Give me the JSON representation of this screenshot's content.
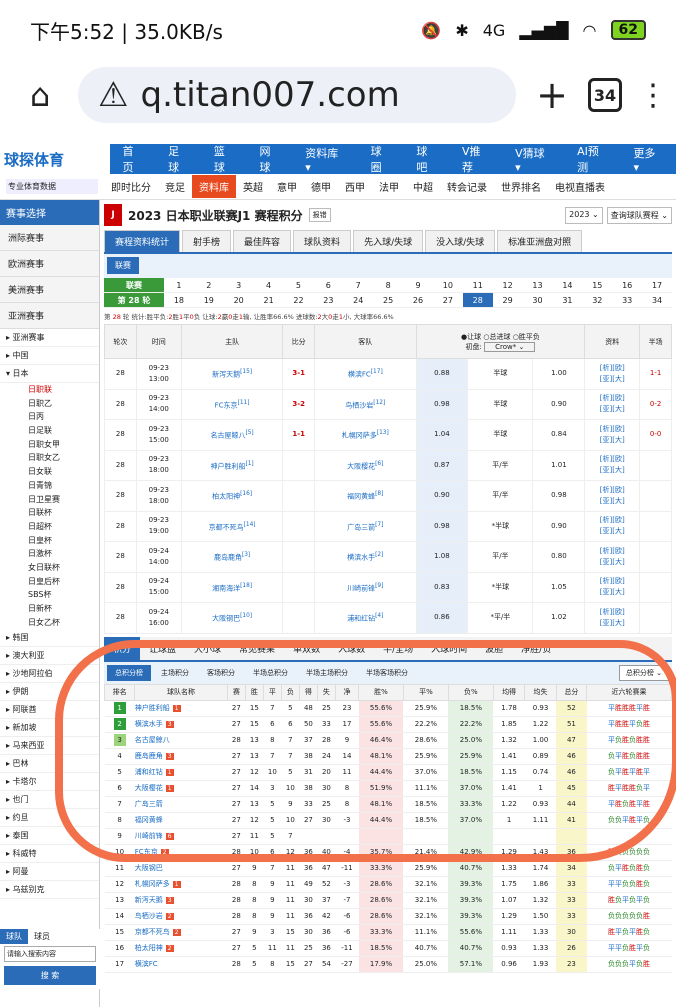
{
  "status": {
    "time": "下午5:52 | 35.0KB/s",
    "network": "4G",
    "battery": "62"
  },
  "browser": {
    "url": "q.titan007.com",
    "tabs_count": "34"
  },
  "site": {
    "logo": "球探体育",
    "nav": [
      "首页",
      "足球",
      "篮球",
      "网球",
      "资料库 ▾",
      "球圈",
      "球吧",
      "V推荐",
      "V猜球 ▾",
      "AI预测",
      "更多 ▾"
    ],
    "sub_brand": "专业体育数据",
    "subnav": [
      "即时比分",
      "竞足",
      "资料库",
      "英超",
      "意甲",
      "德甲",
      "西甲",
      "法甲",
      "中超",
      "转会记录",
      "世界排名",
      "电视直播表"
    ],
    "subnav_active": "资料库"
  },
  "sidebar": {
    "title": "赛事选择",
    "categories": [
      "洲际赛事",
      "欧洲赛事",
      "美洲赛事",
      "亚洲赛事"
    ],
    "countries_top": [
      "▸ 亚洲赛事",
      "▸ 中国",
      "▾ 日本"
    ],
    "leagues": [
      "日职联",
      "日职乙",
      "日丙",
      "日足联",
      "日职女甲",
      "日职女乙",
      "日女联",
      "日青锦",
      "日卫星赛",
      "日联杯",
      "日超杯",
      "日皇杯",
      "日激杯",
      "女日联杯",
      "日皇后杯",
      "SBS杯",
      "日新杯",
      "日女乙杯"
    ],
    "active_league": "日职联",
    "countries_bottom": [
      "▸ 韩国",
      "▸ 澳大利亚",
      "▸ 沙地阿拉伯",
      "▸ 伊朗",
      "▸ 阿联酋",
      "▸ 新加坡",
      "▸ 马来西亚",
      "▸ 巴林",
      "▸ 卡塔尔",
      "▸ 也门",
      "▸ 约旦",
      "▸ 泰国",
      "▸ 科威特",
      "▸ 阿曼",
      "▸ 乌兹别克"
    ],
    "search_tabs": [
      "球队",
      "球员"
    ],
    "search_placeholder": "请输入搜索内容",
    "search_button": "搜 索"
  },
  "page": {
    "logo": "J",
    "title": "2023 日本职业联赛J1 赛程积分",
    "tag": "报错",
    "season": "2023 ⌄",
    "query": "查询球队赛程 ⌄",
    "tabs": [
      "赛程资料统计",
      "射手榜",
      "最佳阵容",
      "球队资料",
      "先入球/失球",
      "没入球/失球",
      "标准亚洲盘对照"
    ],
    "subtab": "联赛",
    "round_label": "联赛",
    "round_current": "第 28 轮",
    "rounds_row1": [
      "1",
      "2",
      "3",
      "4",
      "5",
      "6",
      "7",
      "8",
      "9",
      "10",
      "11",
      "12",
      "13",
      "14",
      "15",
      "16",
      "17"
    ],
    "rounds_row2": [
      "18",
      "19",
      "20",
      "21",
      "22",
      "23",
      "24",
      "25",
      "26",
      "27",
      "28",
      "29",
      "30",
      "31",
      "32",
      "33",
      "34"
    ],
    "selected_round": "28",
    "note": {
      "a": "第 ",
      "round": "28",
      "b": " 轮 统计:胜平负:",
      "w": "2",
      "c": "胜",
      "d": "1",
      "e": "平",
      "f": "0",
      "g": "负 让球:",
      "h": "2",
      "i": "赢",
      "j": "0",
      "k": "走",
      "l": "1",
      "m": "输, 让胜率66.6% 进球数:",
      "n": "2",
      "o": "大",
      "p": "0",
      "q": "走",
      "r": "1",
      "s": "小, 大球率66.6%"
    }
  },
  "fixtures": {
    "headers": [
      "轮次",
      "时间",
      "主队",
      "比分",
      "客队",
      "",
      "",
      "",
      "资料",
      "半场"
    ],
    "handicap_options": [
      "●让球",
      "○总进球",
      "○胜平负"
    ],
    "odds_label": "初盘:",
    "odds_source": "Crow* ⌄",
    "rows": [
      {
        "round": "28",
        "date": "09-23",
        "time": "13:00",
        "home": "新泻天鹅",
        "home_rank": "[15]",
        "score": "3-1",
        "away": "横滨FC",
        "away_rank": "[17]",
        "o1": "0.88",
        "line": "半球",
        "o2": "1.00",
        "half": "1-1"
      },
      {
        "round": "28",
        "date": "09-23",
        "time": "14:00",
        "home": "FC东京",
        "home_rank": "[11]",
        "score": "3-2",
        "away": "鸟栖沙岩",
        "away_rank": "[12]",
        "o1": "0.98",
        "line": "半球",
        "o2": "0.90",
        "half": "0-2"
      },
      {
        "round": "28",
        "date": "09-23",
        "time": "15:00",
        "home": "名古屋鲸八",
        "home_rank": "[5]",
        "score": "1-1",
        "away": "札幌冈萨多",
        "away_rank": "[13]",
        "o1": "1.04",
        "line": "半球",
        "o2": "0.84",
        "half": "0-0"
      },
      {
        "round": "28",
        "date": "09-23",
        "time": "18:00",
        "home": "神户胜利船",
        "home_rank": "[1]",
        "score": "",
        "away": "大阪樱花",
        "away_rank": "[6]",
        "o1": "0.87",
        "line": "平/半",
        "o2": "1.01",
        "half": ""
      },
      {
        "round": "28",
        "date": "09-23",
        "time": "18:00",
        "home": "柏太阳神",
        "home_rank": "[16]",
        "score": "",
        "away": "福冈黄蜂",
        "away_rank": "[8]",
        "o1": "0.90",
        "line": "平/半",
        "o2": "0.98",
        "half": ""
      },
      {
        "round": "28",
        "date": "09-23",
        "time": "19:00",
        "home": "京都不死鸟",
        "home_rank": "[14]",
        "score": "",
        "away": "广岛三箭",
        "away_rank": "[7]",
        "o1": "0.98",
        "line": "*半球",
        "o2": "0.90",
        "half": ""
      },
      {
        "round": "28",
        "date": "09-24",
        "time": "14:00",
        "home": "鹿岛鹿角",
        "home_rank": "[3]",
        "score": "",
        "away": "横滨水手",
        "away_rank": "[2]",
        "o1": "1.08",
        "line": "平/半",
        "o2": "0.80",
        "half": ""
      },
      {
        "round": "28",
        "date": "09-24",
        "time": "15:00",
        "home": "湘南海洋",
        "home_rank": "[18]",
        "score": "",
        "away": "川崎前锋",
        "away_rank": "[9]",
        "o1": "0.83",
        "line": "*半球",
        "o2": "1.05",
        "half": ""
      },
      {
        "round": "28",
        "date": "09-24",
        "time": "16:00",
        "home": "大阪钢巴",
        "home_rank": "[10]",
        "score": "",
        "away": "浦和红钻",
        "away_rank": "[4]",
        "o1": "0.86",
        "line": "*平/半",
        "o2": "1.02",
        "half": ""
      }
    ],
    "links_a": "[析][欧]",
    "links_b": "[亚][大]"
  },
  "stats_tabs": [
    "积分",
    "让球盘",
    "大小球",
    "常见赛果",
    "单双数",
    "入球数",
    "半/全场",
    "入球时间",
    "波胆",
    "净胜/负"
  ],
  "stand_tabs": [
    "总积分榜",
    "主场积分",
    "客场积分",
    "半场总积分",
    "半场主场积分",
    "半场客场积分"
  ],
  "stand_select": "总积分榜 ⌄",
  "standings": {
    "headers": [
      "排名",
      "球队名称",
      "赛",
      "胜",
      "平",
      "负",
      "得",
      "失",
      "净",
      "胜%",
      "平%",
      "负%",
      "均得",
      "均失",
      "总分",
      "近六轮赛果"
    ],
    "rows": [
      {
        "rank": "1",
        "name": "神户胜利船",
        "badge": "1",
        "p": "27",
        "w": "15",
        "d": "7",
        "l": "5",
        "gf": "48",
        "ga": "25",
        "gd": "23",
        "wp": "55.6%",
        "dp": "25.9%",
        "lp": "18.5%",
        "ag": "1.78",
        "al": "0.93",
        "pts": "52",
        "form": [
          "平",
          "胜",
          "胜",
          "胜",
          "平",
          "胜"
        ]
      },
      {
        "rank": "2",
        "name": "横滨水手",
        "badge": "3",
        "p": "27",
        "w": "15",
        "d": "6",
        "l": "6",
        "gf": "50",
        "ga": "33",
        "gd": "17",
        "wp": "55.6%",
        "dp": "22.2%",
        "lp": "22.2%",
        "ag": "1.85",
        "al": "1.22",
        "pts": "51",
        "form": [
          "平",
          "胜",
          "胜",
          "平",
          "负",
          "胜"
        ]
      },
      {
        "rank": "3",
        "name": "名古屋鲸八",
        "badge": "",
        "p": "28",
        "w": "13",
        "d": "8",
        "l": "7",
        "gf": "37",
        "ga": "28",
        "gd": "9",
        "wp": "46.4%",
        "dp": "28.6%",
        "lp": "25.0%",
        "ag": "1.32",
        "al": "1.00",
        "pts": "47",
        "form": [
          "平",
          "负",
          "胜",
          "负",
          "胜",
          "胜"
        ]
      },
      {
        "rank": "4",
        "name": "鹿岛鹿角",
        "badge": "3",
        "p": "27",
        "w": "13",
        "d": "7",
        "l": "7",
        "gf": "38",
        "ga": "24",
        "gd": "14",
        "wp": "48.1%",
        "dp": "25.9%",
        "lp": "25.9%",
        "ag": "1.41",
        "al": "0.89",
        "pts": "46",
        "form": [
          "负",
          "平",
          "胜",
          "负",
          "胜",
          "胜"
        ]
      },
      {
        "rank": "5",
        "name": "浦和红钻",
        "badge": "1",
        "p": "27",
        "w": "12",
        "d": "10",
        "l": "5",
        "gf": "31",
        "ga": "20",
        "gd": "11",
        "wp": "44.4%",
        "dp": "37.0%",
        "lp": "18.5%",
        "ag": "1.15",
        "al": "0.74",
        "pts": "46",
        "form": [
          "负",
          "平",
          "胜",
          "平",
          "胜",
          "平"
        ]
      },
      {
        "rank": "6",
        "name": "大阪樱花",
        "badge": "1",
        "p": "27",
        "w": "14",
        "d": "3",
        "l": "10",
        "gf": "38",
        "ga": "30",
        "gd": "8",
        "wp": "51.9%",
        "dp": "11.1%",
        "lp": "37.0%",
        "ag": "1.41",
        "al": "1",
        "pts": "45",
        "form": [
          "胜",
          "平",
          "胜",
          "胜",
          "负",
          "平"
        ]
      },
      {
        "rank": "7",
        "name": "广岛三箭",
        "badge": "",
        "p": "27",
        "w": "13",
        "d": "5",
        "l": "9",
        "gf": "33",
        "ga": "25",
        "gd": "8",
        "wp": "48.1%",
        "dp": "18.5%",
        "lp": "33.3%",
        "ag": "1.22",
        "al": "0.93",
        "pts": "44",
        "form": [
          "平",
          "胜",
          "负",
          "胜",
          "平",
          "胜"
        ]
      },
      {
        "rank": "8",
        "name": "福冈黄蜂",
        "badge": "",
        "p": "27",
        "w": "12",
        "d": "5",
        "l": "10",
        "gf": "27",
        "ga": "30",
        "gd": "-3",
        "wp": "44.4%",
        "dp": "18.5%",
        "lp": "37.0%",
        "ag": "1",
        "al": "1.11",
        "pts": "41",
        "form": [
          "负",
          "负",
          "平",
          "胜",
          "平",
          "负"
        ]
      },
      {
        "rank": "9",
        "name": "川崎前锋",
        "badge": "6",
        "p": "27",
        "w": "11",
        "d": "5",
        "l": "7",
        "gf": "",
        "ga": "",
        "gd": "",
        "wp": "",
        "dp": "",
        "lp": "",
        "ag": "",
        "al": "",
        "pts": "",
        "form": [
          "",
          "",
          "",
          "",
          "",
          ""
        ]
      },
      {
        "rank": "10",
        "name": "FC东京",
        "badge": "2",
        "p": "28",
        "w": "10",
        "d": "6",
        "l": "12",
        "gf": "36",
        "ga": "40",
        "gd": "-4",
        "wp": "35.7%",
        "dp": "21.4%",
        "lp": "42.9%",
        "ag": "1.29",
        "al": "1.43",
        "pts": "36",
        "form": [
          "胜",
          "负",
          "负",
          "负",
          "负",
          "负"
        ]
      },
      {
        "rank": "11",
        "name": "大阪钢巴",
        "badge": "",
        "p": "27",
        "w": "9",
        "d": "7",
        "l": "11",
        "gf": "36",
        "ga": "47",
        "gd": "-11",
        "wp": "33.3%",
        "dp": "25.9%",
        "lp": "40.7%",
        "ag": "1.33",
        "al": "1.74",
        "pts": "34",
        "form": [
          "负",
          "平",
          "胜",
          "负",
          "胜",
          "负"
        ]
      },
      {
        "rank": "12",
        "name": "札幌冈萨多",
        "badge": "1",
        "p": "28",
        "w": "8",
        "d": "9",
        "l": "11",
        "gf": "49",
        "ga": "52",
        "gd": "-3",
        "wp": "28.6%",
        "dp": "32.1%",
        "lp": "39.3%",
        "ag": "1.75",
        "al": "1.86",
        "pts": "33",
        "form": [
          "平",
          "平",
          "负",
          "负",
          "胜",
          "负"
        ]
      },
      {
        "rank": "13",
        "name": "新泻天鹅",
        "badge": "3",
        "p": "28",
        "w": "8",
        "d": "9",
        "l": "11",
        "gf": "30",
        "ga": "37",
        "gd": "-7",
        "wp": "28.6%",
        "dp": "32.1%",
        "lp": "39.3%",
        "ag": "1.07",
        "al": "1.32",
        "pts": "33",
        "form": [
          "胜",
          "负",
          "平",
          "负",
          "平",
          "负"
        ]
      },
      {
        "rank": "14",
        "name": "鸟栖沙岩",
        "badge": "2",
        "p": "28",
        "w": "8",
        "d": "9",
        "l": "11",
        "gf": "36",
        "ga": "42",
        "gd": "-6",
        "wp": "28.6%",
        "dp": "32.1%",
        "lp": "39.3%",
        "ag": "1.29",
        "al": "1.50",
        "pts": "33",
        "form": [
          "负",
          "负",
          "负",
          "负",
          "负",
          "胜"
        ]
      },
      {
        "rank": "15",
        "name": "京都不死鸟",
        "badge": "2",
        "p": "27",
        "w": "9",
        "d": "3",
        "l": "15",
        "gf": "30",
        "ga": "36",
        "gd": "-6",
        "wp": "33.3%",
        "dp": "11.1%",
        "lp": "55.6%",
        "ag": "1.11",
        "al": "1.33",
        "pts": "30",
        "form": [
          "胜",
          "平",
          "负",
          "平",
          "胜",
          "负"
        ]
      },
      {
        "rank": "16",
        "name": "柏太阳神",
        "badge": "2",
        "p": "27",
        "w": "5",
        "d": "11",
        "l": "11",
        "gf": "25",
        "ga": "36",
        "gd": "-11",
        "wp": "18.5%",
        "dp": "40.7%",
        "lp": "40.7%",
        "ag": "0.93",
        "al": "1.33",
        "pts": "26",
        "form": [
          "平",
          "平",
          "负",
          "胜",
          "平",
          "负"
        ]
      },
      {
        "rank": "17",
        "name": "横滨FC",
        "badge": "",
        "p": "28",
        "w": "5",
        "d": "8",
        "l": "15",
        "gf": "27",
        "ga": "54",
        "gd": "-27",
        "wp": "17.9%",
        "dp": "25.0%",
        "lp": "57.1%",
        "ag": "0.96",
        "al": "1.93",
        "pts": "23",
        "form": [
          "负",
          "负",
          "负",
          "平",
          "负",
          "胜"
        ]
      }
    ]
  },
  "colors": {
    "primary": "#1a6cc4",
    "accent": "#e84a1f",
    "green": "#2e9e3a",
    "annotation": "#f2704a"
  }
}
